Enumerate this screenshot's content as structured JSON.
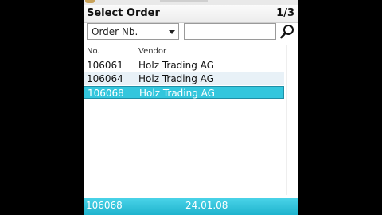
{
  "header": {
    "title": "Select Order",
    "page_counter": "1/3"
  },
  "search": {
    "field_select_value": "Order Nb.",
    "input_value": "",
    "search_icon": "search-icon"
  },
  "list": {
    "columns": [
      "No.",
      "Vendor"
    ],
    "rows": [
      {
        "no": "106061",
        "vendor": "Holz Trading AG",
        "selected": false
      },
      {
        "no": "106064",
        "vendor": "Holz Trading AG",
        "selected": false
      },
      {
        "no": "106068",
        "vendor": "Holz Trading AG",
        "selected": true
      }
    ]
  },
  "status": {
    "order_no": "106068",
    "date": "24.01.08"
  },
  "colors": {
    "selection": "#33c6dd",
    "status_bar": "#1fb3cd",
    "alt_row": "#e8f1f7"
  }
}
